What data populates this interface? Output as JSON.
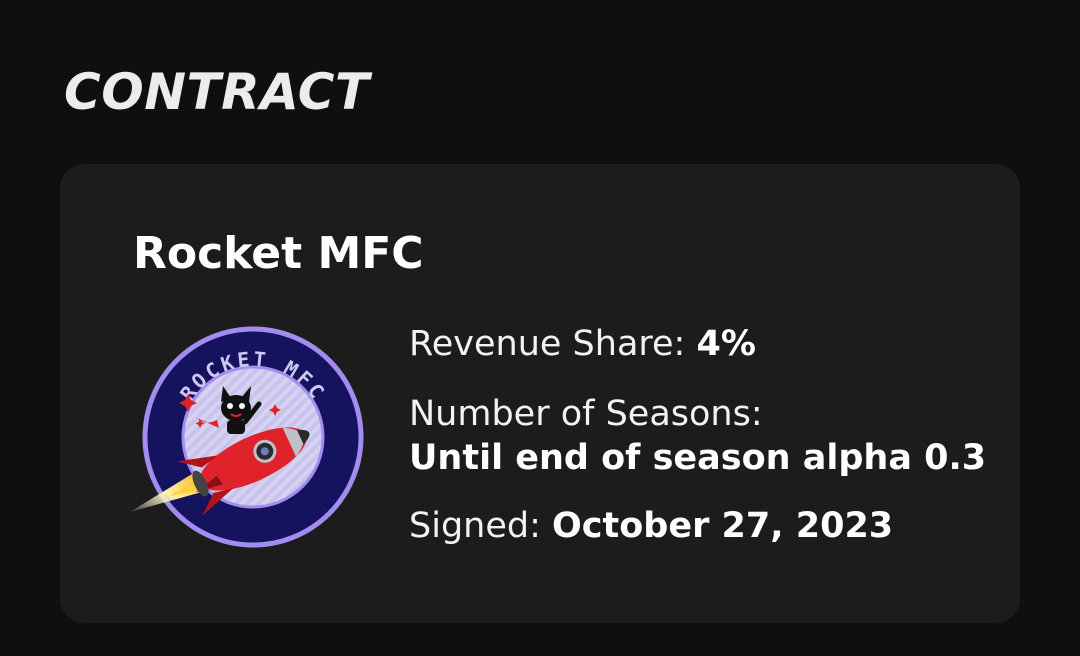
{
  "section": {
    "title": "CONTRACT"
  },
  "contract": {
    "club_name": "Rocket MFC",
    "logo": {
      "icon": "rocket-mfc-logo-icon",
      "text": "ROCKET MFC"
    },
    "revenue_share": {
      "label": "Revenue Share:",
      "value": "4%"
    },
    "seasons": {
      "label": "Number of Seasons:",
      "value": "Until end of season alpha 0.3"
    },
    "signed": {
      "label": "Signed:",
      "value": "October 27, 2023"
    }
  },
  "colors": {
    "background": "#0f0f0f",
    "card": "#1c1c1c",
    "logo_ring": "#15135e",
    "logo_border": "#a38cf0",
    "logo_inner": "#d6d2f2",
    "rocket_red": "#e0232a"
  }
}
